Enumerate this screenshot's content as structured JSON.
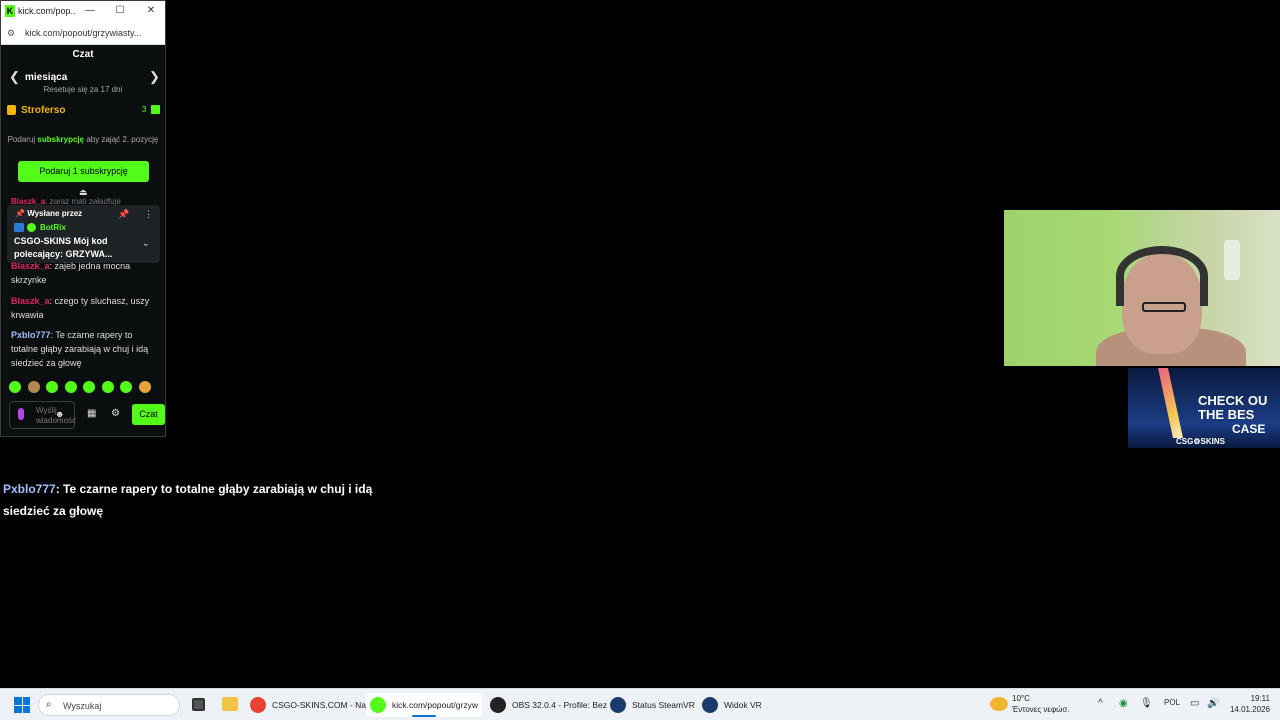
{
  "popup": {
    "tab_title": "kick.com/pop...",
    "url": "kick.com/popout/grzywiasty...",
    "minimize": "—",
    "maximize": "☐",
    "close": "✕",
    "chat_title": "Czat",
    "leaderboard": {
      "period": "miesiąca",
      "reset_text": "Resetuje się za 17 dni",
      "top_user": "Stroferso",
      "top_count": "3"
    },
    "promo": {
      "prefix": "Podaruj",
      "highlight": "subskrypcję",
      "suffix": "aby zająć 2. pozycję"
    },
    "gift_button": "Podaruj 1 subskrypcję",
    "partial_top": {
      "user": "Blaszk_a",
      "text": ": zaraz mati załadfuje"
    },
    "pinned": {
      "header": "Wysłane przez",
      "user": "BotRix",
      "message": "CSGO-SKINS Mój kod polecający: GRZYWA..."
    },
    "partial_msg": {
      "user": "Blaszk_a",
      "text": ": zajeb jedna mocna skrzynke"
    },
    "messages": [
      {
        "user": "Blaszk_a",
        "text": ": czego ty sluchasz, uszy krwawia"
      },
      {
        "user": "Pxblo777",
        "text": ": Te czarne rapery to totalne głąby zarabiają w chuj i idą siedzieć za głowę"
      }
    ],
    "input_placeholder": "Wyślij wiadomość",
    "send_button": "Czat",
    "emote_colors": [
      "#53fc18",
      "#b2884f",
      "#53fc18",
      "#53fc18",
      "#53fc18",
      "#53fc18",
      "#53fc18",
      "#e8a23a"
    ]
  },
  "overlay": {
    "user": "Pxblo777",
    "text": ": Te czarne rapery to totalne głąby zarabiają w chuj i idą siedzieć za głowę"
  },
  "ad": {
    "line1": "CHECK OU",
    "line2": "THE BES",
    "line3": "CASE",
    "brand": "CSG⚙SKINS"
  },
  "taskbar": {
    "search_label": "Wyszukaj",
    "items": [
      {
        "label": "CSGO-SKINS.COM - Naj",
        "color": "#e94235"
      },
      {
        "label": "kick.com/popout/grzyw",
        "color": "#53fc18"
      },
      {
        "label": "OBS 32.0.4 - Profile: Bez",
        "color": "#222222"
      },
      {
        "label": "Status SteamVR",
        "color": "#1b3b6f"
      },
      {
        "label": "Widok VR",
        "color": "#1b3b6f"
      }
    ],
    "weather_temp": "10°C",
    "weather_desc": "Έντονες νεφώσ.",
    "lang": "POL",
    "time": "19:11",
    "date": "14.01.2026"
  }
}
